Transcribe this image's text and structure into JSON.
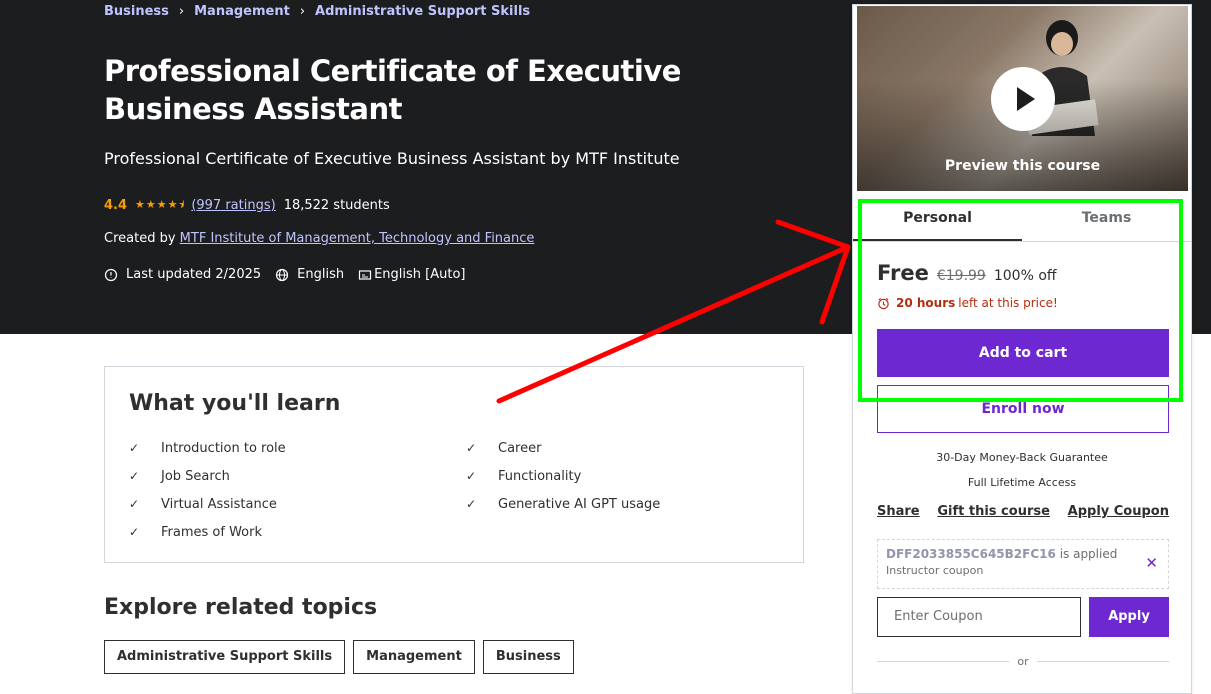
{
  "breadcrumb": [
    "Business",
    "Management",
    "Administrative Support Skills"
  ],
  "course": {
    "title": "Professional Certificate of Executive Business Assistant",
    "subtitle": "Professional Certificate of Executive Business Assistant by MTF Institute",
    "rating": "4.4",
    "ratings_count": "(997 ratings)",
    "students": "18,522 students",
    "created_by_label": "Created by",
    "creator": "MTF Institute of Management, Technology and Finance",
    "last_updated": "Last updated 2/2025",
    "language": "English",
    "captions": "English [Auto]"
  },
  "learn": {
    "heading": "What you'll learn",
    "items": [
      "Introduction to role",
      "Career",
      "Job Search",
      "Functionality",
      "Virtual Assistance",
      "Generative AI GPT usage",
      "Frames of Work"
    ]
  },
  "explore": {
    "heading": "Explore related topics",
    "topics": [
      "Administrative Support Skills",
      "Management",
      "Business"
    ]
  },
  "sidebar": {
    "preview_label": "Preview this course",
    "tabs": [
      "Personal",
      "Teams"
    ],
    "price": "Free",
    "original_price": "€19.99",
    "discount": "100% off",
    "timer_bold": "20 hours",
    "timer_rest": "left at this price!",
    "add_to_cart": "Add to cart",
    "enroll": "Enroll now",
    "guarantee": "30-Day Money-Back Guarantee",
    "access": "Full Lifetime Access",
    "links": [
      "Share",
      "Gift this course",
      "Apply Coupon"
    ],
    "coupon_code": "DFF2033855C645B2FC16",
    "coupon_applied": "is applied",
    "coupon_type": "Instructor coupon",
    "coupon_placeholder": "Enter Coupon",
    "apply": "Apply",
    "or": "or"
  },
  "colors": {
    "hero_bg": "#1c1d1f",
    "accent": "#6d28d2",
    "star": "#f69c08",
    "annotation_arrow": "#ff0000",
    "annotation_box": "#00ff00"
  }
}
